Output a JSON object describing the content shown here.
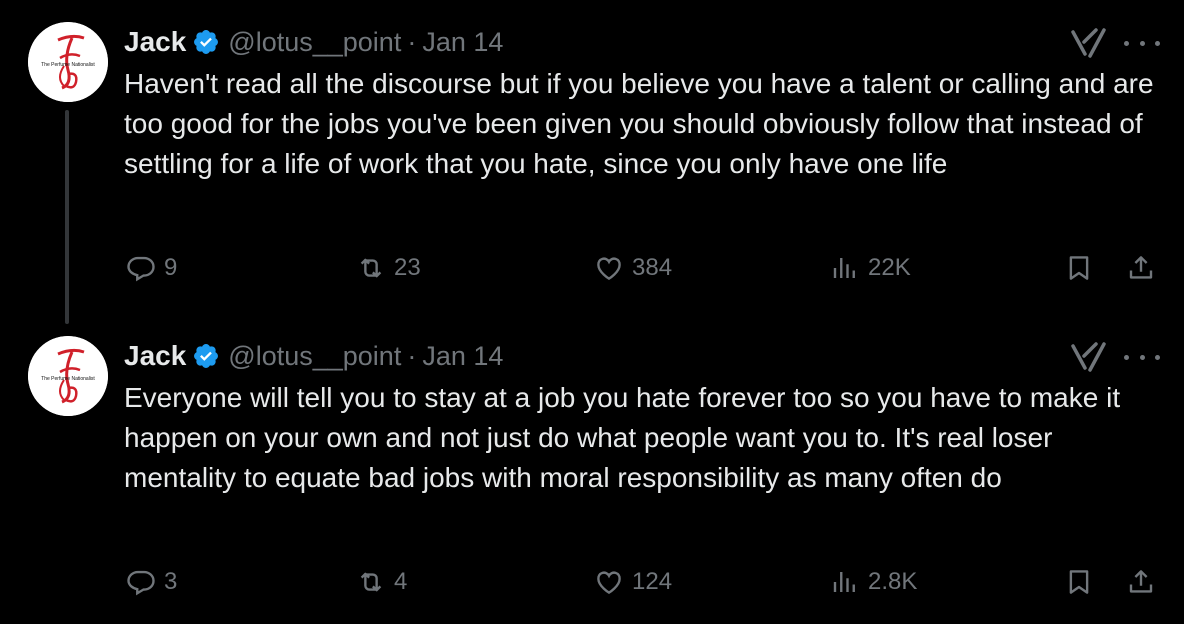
{
  "tweets": [
    {
      "author_name": "Jack",
      "handle": "@lotus__point",
      "separator": "·",
      "date": "Jan 14",
      "text": "Haven't read all the discourse but if you believe you have a talent or calling and are too good for the jobs you've been given you should obviously follow that instead of settling for a life of work that you hate, since you only have one life",
      "replies": "9",
      "reposts": "23",
      "likes": "384",
      "views": "22K",
      "avatar_caption": "The Perfume Nationalist"
    },
    {
      "author_name": "Jack",
      "handle": "@lotus__point",
      "separator": "·",
      "date": "Jan 14",
      "text": "Everyone will tell you to stay at a job you hate forever too so you have to make it happen on your own and not just do what people want you to. It's real loser mentality to equate bad jobs with moral responsibility as many often do",
      "replies": "3",
      "reposts": "4",
      "likes": "124",
      "views": "2.8K",
      "avatar_caption": "The Perfume Nationalist"
    }
  ],
  "icons": {
    "verified": "verified-badge-icon",
    "grok": "grok-icon",
    "more": "more-options-icon",
    "reply": "reply-icon",
    "repost": "repost-icon",
    "like": "heart-icon",
    "views": "views-icon",
    "bookmark": "bookmark-icon",
    "share": "share-icon"
  },
  "colors": {
    "background": "#000000",
    "text_primary": "#e7e9ea",
    "text_secondary": "#71767b",
    "verified_blue": "#1d9bf0",
    "avatar_logo_red": "#d0202a"
  }
}
